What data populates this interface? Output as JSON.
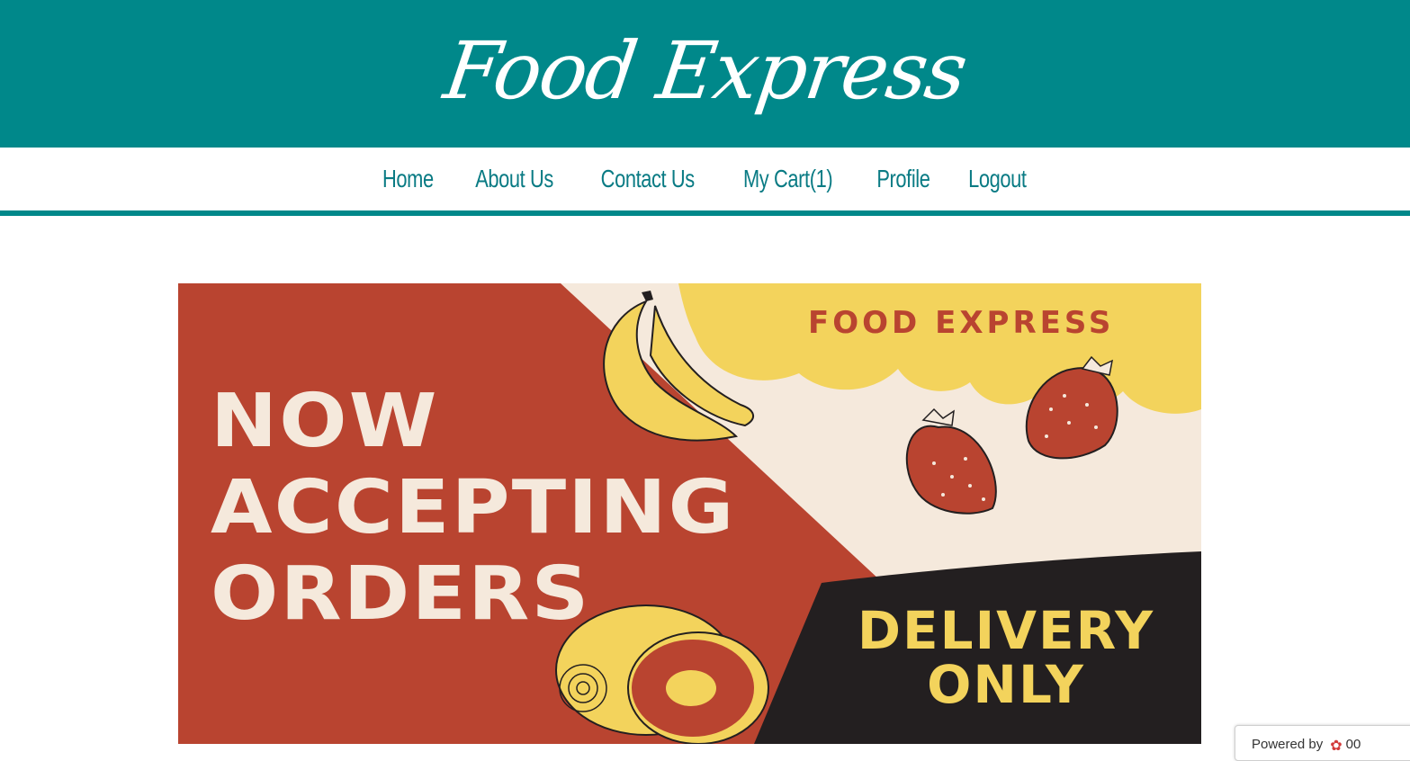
{
  "header": {
    "title": "Food Express",
    "background": "#00888a"
  },
  "nav": {
    "items": [
      {
        "label": "Home"
      },
      {
        "label": "About Us"
      },
      {
        "label": "Contact Us"
      },
      {
        "label": "My Cart(1)"
      },
      {
        "label": "Profile"
      },
      {
        "label": "Logout"
      }
    ],
    "color": "#0a7b84"
  },
  "banner": {
    "brand": "FOOD EXPRESS",
    "headline": [
      "NOW",
      "ACCEPTING",
      "ORDERS"
    ],
    "delivery": [
      "DELIVERY",
      "ONLY"
    ],
    "colors": {
      "red": "#b94430",
      "cream": "#f5e9dc",
      "yellow": "#f3d35c",
      "dark": "#231f20"
    }
  },
  "badge": {
    "text": "Powered by",
    "brand": "00"
  }
}
